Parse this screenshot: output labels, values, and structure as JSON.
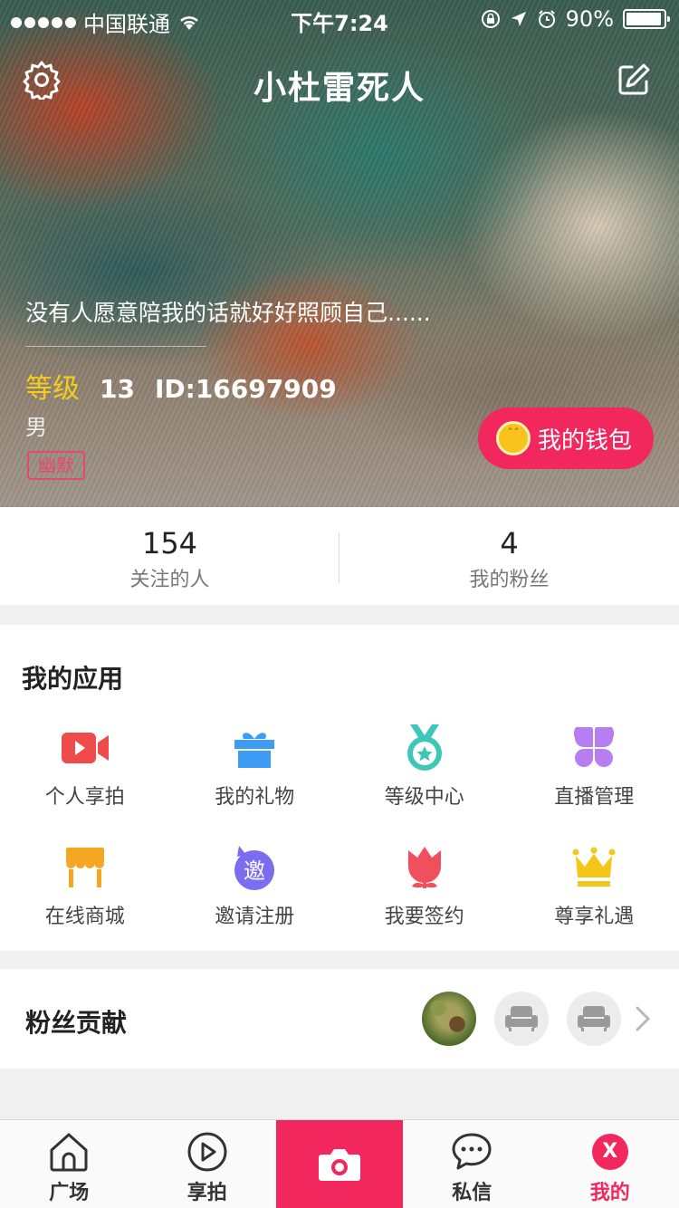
{
  "status_bar": {
    "carrier": "中国联通",
    "time": "下午7:24",
    "battery": "90%"
  },
  "header": {
    "title": "小杜雷死人",
    "signature": "没有人愿意陪我的话就好好照顾自己......",
    "level_label": "等级",
    "level_value": "13",
    "id_text": "ID:16697909",
    "gender": "男",
    "tag": "幽默",
    "wallet_label": "我的钱包",
    "accent_color": "#f2275e",
    "level_color": "#f5cd1a"
  },
  "stats": [
    {
      "value": "154",
      "label": "关注的人"
    },
    {
      "value": "4",
      "label": "我的粉丝"
    }
  ],
  "apps": {
    "title": "我的应用",
    "items": [
      {
        "label": "个人享拍",
        "icon": "video-camera-icon",
        "color": "#f04b4b"
      },
      {
        "label": "我的礼物",
        "icon": "gift-icon",
        "color": "#3d9cf5"
      },
      {
        "label": "等级中心",
        "icon": "medal-icon",
        "color": "#3cc7b8"
      },
      {
        "label": "直播管理",
        "icon": "clover-grid-icon",
        "color": "#b77df2"
      },
      {
        "label": "在线商城",
        "icon": "shop-icon",
        "color": "#f5a623"
      },
      {
        "label": "邀请注册",
        "icon": "invite-icon",
        "color": "#7b6cf0",
        "glyph": "邀"
      },
      {
        "label": "我要签约",
        "icon": "tulip-icon",
        "color": "#f0505e"
      },
      {
        "label": "尊享礼遇",
        "icon": "crown-icon",
        "color": "#f5c518"
      }
    ]
  },
  "fans": {
    "title": "粉丝贡献"
  },
  "tabbar": [
    {
      "label": "广场",
      "icon": "home-icon"
    },
    {
      "label": "享拍",
      "icon": "play-circle-icon"
    },
    {
      "label": "",
      "icon": "camera-icon"
    },
    {
      "label": "私信",
      "icon": "chat-bubble-icon"
    },
    {
      "label": "我的",
      "icon": "profile-badge-icon",
      "badge": "X"
    }
  ]
}
